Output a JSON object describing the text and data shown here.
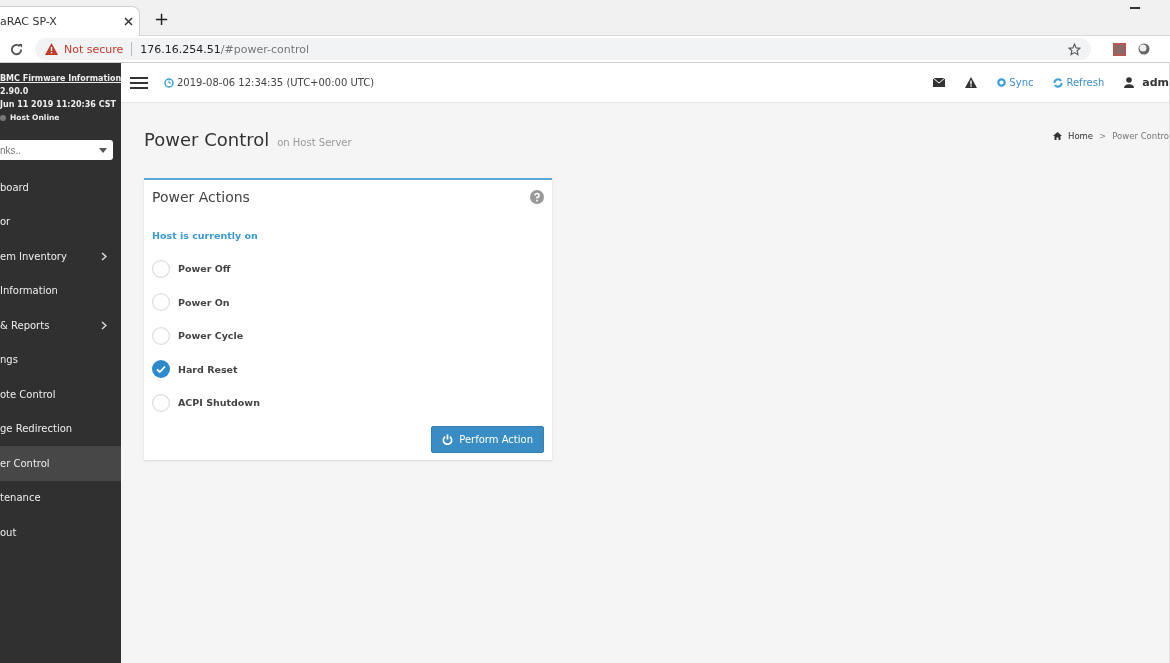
{
  "browser": {
    "tab_title": "aRAC SP-X",
    "new_tab": "+",
    "security": "Not secure",
    "url_host": "176.16.254.51",
    "url_path": "/#power-control"
  },
  "topbar": {
    "datetime": "2019-08-06 12:34:35 (UTC+00:00 UTC)",
    "sync": "Sync",
    "refresh": "Refresh",
    "user": "adm"
  },
  "sidebar": {
    "firmware_link": "BMC Firmware Information",
    "version": "2.90.0",
    "build_date": "Jun 11 2019 11:20:36 CST",
    "host_status": "Host Online",
    "quick_links": {
      "placeholder": "nks.."
    },
    "items": [
      {
        "label": "board",
        "has_children": false,
        "selected": false
      },
      {
        "label": "or",
        "has_children": false,
        "selected": false
      },
      {
        "label": "em Inventory",
        "has_children": true,
        "selected": false
      },
      {
        "label": "Information",
        "has_children": false,
        "selected": false
      },
      {
        "label": "& Reports",
        "has_children": true,
        "selected": false
      },
      {
        "label": "ngs",
        "has_children": false,
        "selected": false
      },
      {
        "label": "ote Control",
        "has_children": false,
        "selected": false
      },
      {
        "label": "ge Redirection",
        "has_children": false,
        "selected": false
      },
      {
        "label": "er Control",
        "has_children": false,
        "selected": true
      },
      {
        "label": "tenance",
        "has_children": false,
        "selected": false
      },
      {
        "label": "out",
        "has_children": false,
        "selected": false
      }
    ]
  },
  "page": {
    "title": "Power Control",
    "subtitle": "on Host Server",
    "breadcrumb": [
      "Home",
      "Power Contro"
    ],
    "breadcrumb_separator": ">"
  },
  "panel": {
    "title": "Power Actions",
    "status": "Host is currently on",
    "options": [
      {
        "label": "Power Off",
        "selected": false
      },
      {
        "label": "Power On",
        "selected": false
      },
      {
        "label": "Power Cycle",
        "selected": false
      },
      {
        "label": "Hard Reset",
        "selected": true
      },
      {
        "label": "ACPI Shutdown",
        "selected": false
      }
    ],
    "button": "Perform Action"
  }
}
